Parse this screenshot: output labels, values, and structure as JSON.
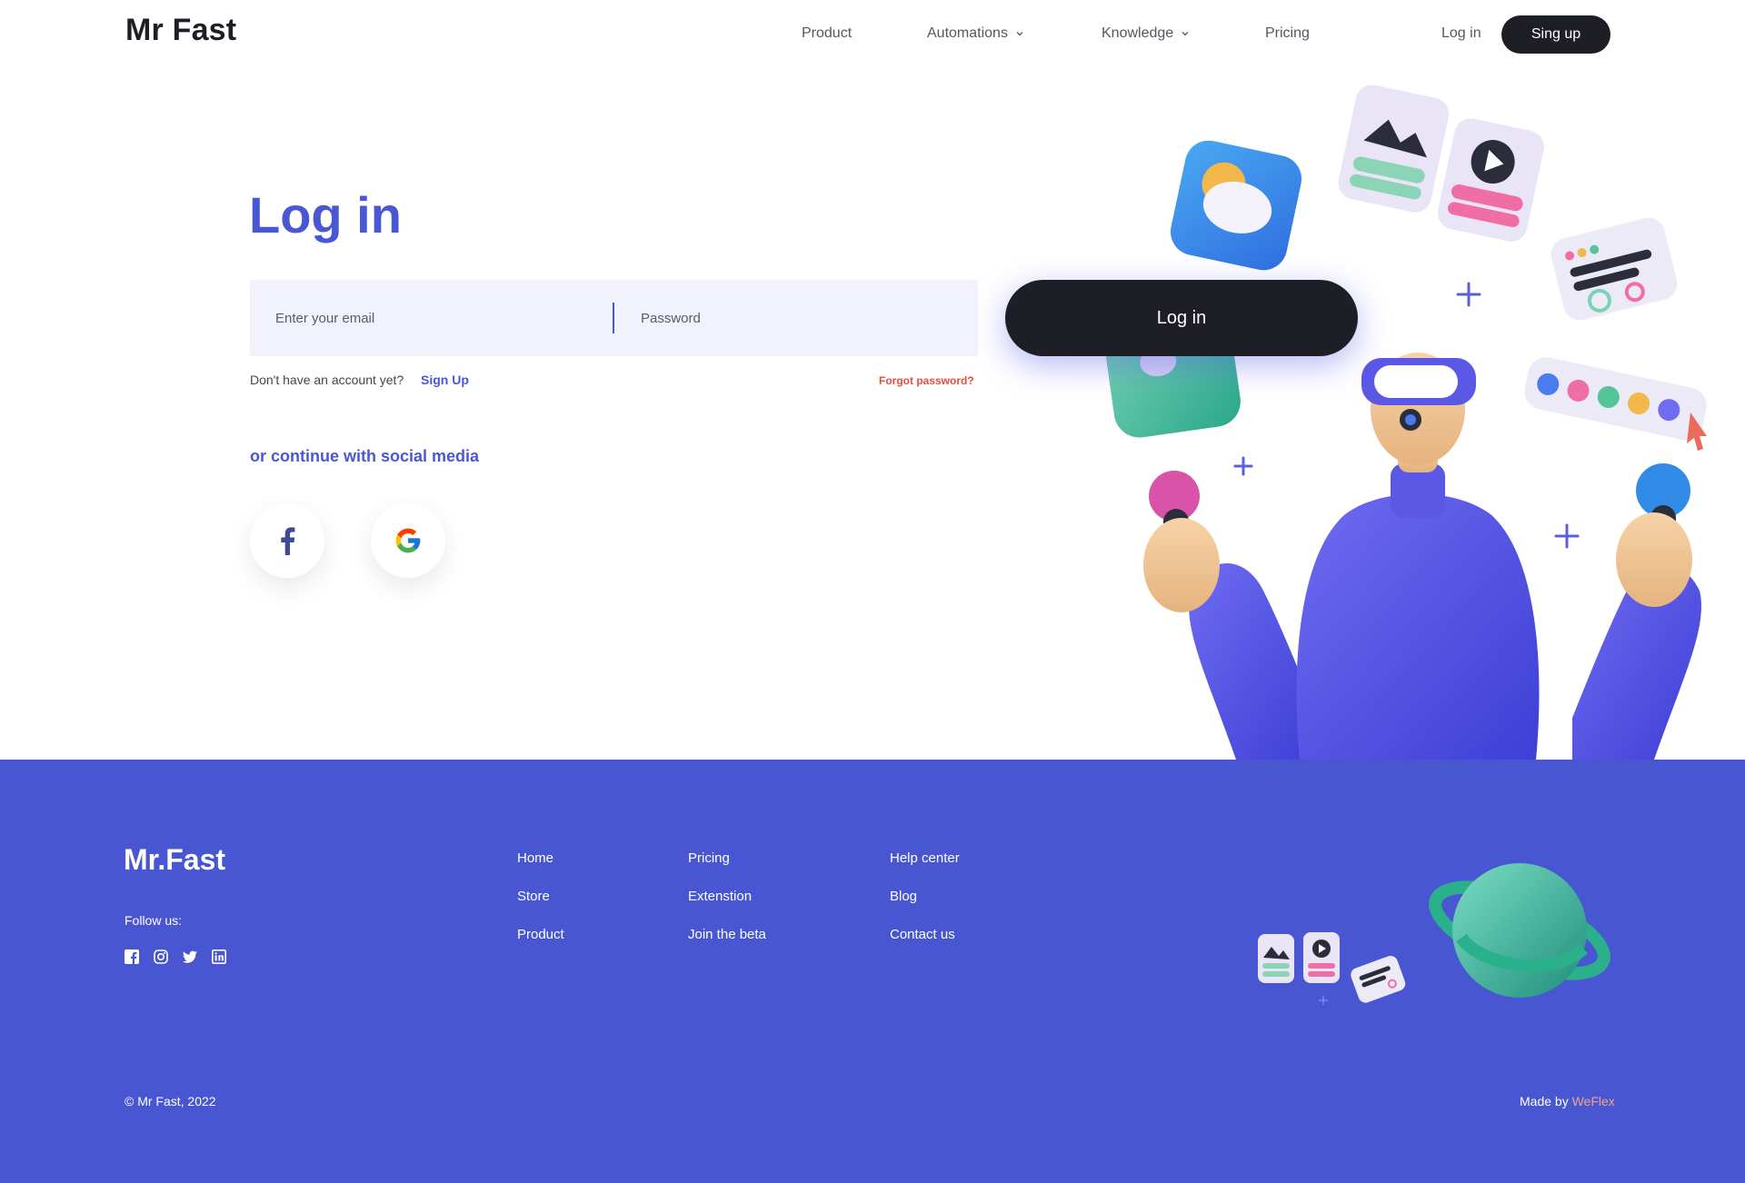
{
  "header": {
    "logo": "Mr Fast",
    "nav": [
      {
        "label": "Product",
        "has_dropdown": false
      },
      {
        "label": "Automations",
        "has_dropdown": true
      },
      {
        "label": "Knowledge",
        "has_dropdown": true
      },
      {
        "label": "Pricing",
        "has_dropdown": false
      }
    ],
    "login_label": "Log in",
    "signup_label": "Sing up"
  },
  "login": {
    "title": "Log in",
    "email_placeholder": "Enter your email",
    "password_placeholder": "Password",
    "submit_label": "Log in",
    "no_account_text": "Don't have an account yet?",
    "signup_link": "Sign Up",
    "forgot_password": "Forgot password?",
    "social_title": "or continue with social media",
    "social": [
      {
        "name": "facebook",
        "icon": "facebook-icon"
      },
      {
        "name": "google",
        "icon": "google-icon"
      }
    ]
  },
  "footer": {
    "logo": "Mr.Fast",
    "follow_label": "Follow us:",
    "social_icons": [
      "facebook-icon",
      "instagram-icon",
      "twitter-icon",
      "linkedin-icon"
    ],
    "columns": [
      [
        "Home",
        "Store",
        "Product"
      ],
      [
        "Pricing",
        "Extenstion",
        "Join the beta"
      ],
      [
        "Help center",
        "Blog",
        "Contact us"
      ]
    ],
    "copyright": "© Mr Fast, 2022",
    "made_by_prefix": "Made by",
    "made_by_brand": "WeFlex"
  },
  "colors": {
    "accent": "#4a57d3",
    "footer_bg": "#4857d1",
    "dark": "#1e1f26",
    "danger": "#e74c3c",
    "input_bg": "#f1f2fc",
    "brand_link": "#f2a38f"
  }
}
